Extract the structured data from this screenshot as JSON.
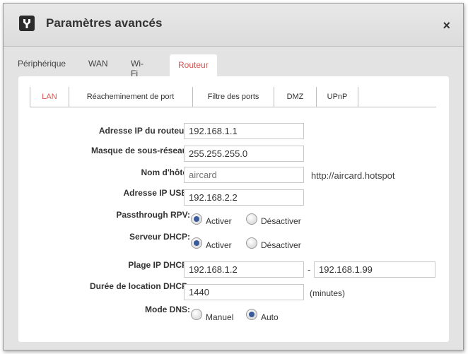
{
  "dialog": {
    "title": "Paramètres avancés",
    "close_label": "×"
  },
  "tabs": [
    {
      "label": "Périphérique"
    },
    {
      "label": "WAN"
    },
    {
      "label": "Wi-Fi"
    },
    {
      "label": "Routeur",
      "active": true
    }
  ],
  "subtabs": [
    {
      "label": "LAN",
      "active": true
    },
    {
      "label": "Réacheminement de port"
    },
    {
      "label": "Filtre des ports"
    },
    {
      "label": "DMZ"
    },
    {
      "label": "UPnP"
    }
  ],
  "form": {
    "router_ip": {
      "label": "Adresse IP du routeur:",
      "value": "192.168.1.1"
    },
    "subnet_mask": {
      "label": "Masque de sous-réseau:",
      "value": "255.255.255.0"
    },
    "hostname": {
      "label": "Nom d'hôte:",
      "value": "aircard",
      "url": "http://aircard.hotspot"
    },
    "usb_ip": {
      "label": "Adresse IP USB:",
      "value": "192.168.2.2"
    },
    "vpn_passthrough": {
      "label": "Passthrough RPV:",
      "option_on": "Activer",
      "option_off": "Désactiver",
      "selected": "Activer"
    },
    "dhcp_server": {
      "label": "Serveur DHCP:",
      "option_on": "Activer",
      "option_off": "Désactiver",
      "selected": "Activer"
    },
    "dhcp_range": {
      "label": "Plage IP DHCP:",
      "start": "192.168.1.2",
      "separator": "-",
      "end": "192.168.1.99"
    },
    "lease_time": {
      "label": "Durée de location DHCP:",
      "value": "1440",
      "unit": "(minutes)"
    },
    "dns_mode": {
      "label": "Mode DNS:",
      "option_manual": "Manuel",
      "option_auto": "Auto",
      "selected": "Auto"
    }
  },
  "colors": {
    "accent": "#d9534f",
    "radio_fill": "#3a5a9a"
  }
}
